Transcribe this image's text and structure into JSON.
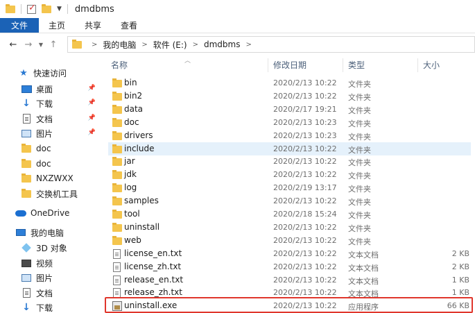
{
  "window": {
    "title": "dmdbms"
  },
  "ribbon": {
    "tabs": [
      "文件",
      "主页",
      "共享",
      "查看"
    ]
  },
  "address": {
    "crumbs": [
      "我的电脑",
      "软件 (E:)",
      "dmdbms"
    ]
  },
  "sidebar": {
    "quick_access": "快速访问",
    "pinned": [
      {
        "label": "桌面",
        "icon": "desktop-icon"
      },
      {
        "label": "下载",
        "icon": "download-icon"
      },
      {
        "label": "文档",
        "icon": "document-icon"
      },
      {
        "label": "图片",
        "icon": "pictures-icon"
      }
    ],
    "recent": [
      "doc",
      "doc",
      "NXZWXX",
      "交换机工具"
    ],
    "onedrive": "OneDrive",
    "this_pc": "我的电脑",
    "pc_items": [
      {
        "label": "3D 对象",
        "icon": "3d-objects-icon"
      },
      {
        "label": "视频",
        "icon": "video-icon"
      },
      {
        "label": "图片",
        "icon": "pictures-icon"
      },
      {
        "label": "文档",
        "icon": "document-icon"
      },
      {
        "label": "下载",
        "icon": "download-icon"
      }
    ]
  },
  "columns": {
    "name": "名称",
    "date": "修改日期",
    "type": "类型",
    "size": "大小"
  },
  "files": [
    {
      "name": "bin",
      "date": "2020/2/13 10:22",
      "type": "文件夹",
      "size": "",
      "kind": "folder"
    },
    {
      "name": "bin2",
      "date": "2020/2/13 10:22",
      "type": "文件夹",
      "size": "",
      "kind": "folder"
    },
    {
      "name": "data",
      "date": "2020/2/17 19:21",
      "type": "文件夹",
      "size": "",
      "kind": "folder"
    },
    {
      "name": "doc",
      "date": "2020/2/13 10:23",
      "type": "文件夹",
      "size": "",
      "kind": "folder"
    },
    {
      "name": "drivers",
      "date": "2020/2/13 10:23",
      "type": "文件夹",
      "size": "",
      "kind": "folder"
    },
    {
      "name": "include",
      "date": "2020/2/13 10:22",
      "type": "文件夹",
      "size": "",
      "kind": "folder",
      "selected": true
    },
    {
      "name": "jar",
      "date": "2020/2/13 10:22",
      "type": "文件夹",
      "size": "",
      "kind": "folder"
    },
    {
      "name": "jdk",
      "date": "2020/2/13 10:22",
      "type": "文件夹",
      "size": "",
      "kind": "folder"
    },
    {
      "name": "log",
      "date": "2020/2/19 13:17",
      "type": "文件夹",
      "size": "",
      "kind": "folder"
    },
    {
      "name": "samples",
      "date": "2020/2/13 10:22",
      "type": "文件夹",
      "size": "",
      "kind": "folder"
    },
    {
      "name": "tool",
      "date": "2020/2/18 15:24",
      "type": "文件夹",
      "size": "",
      "kind": "folder"
    },
    {
      "name": "uninstall",
      "date": "2020/2/13 10:22",
      "type": "文件夹",
      "size": "",
      "kind": "folder"
    },
    {
      "name": "web",
      "date": "2020/2/13 10:22",
      "type": "文件夹",
      "size": "",
      "kind": "folder"
    },
    {
      "name": "license_en.txt",
      "date": "2020/2/13 10:22",
      "type": "文本文档",
      "size": "2 KB",
      "kind": "txt"
    },
    {
      "name": "license_zh.txt",
      "date": "2020/2/13 10:22",
      "type": "文本文档",
      "size": "2 KB",
      "kind": "txt"
    },
    {
      "name": "release_en.txt",
      "date": "2020/2/13 10:22",
      "type": "文本文档",
      "size": "1 KB",
      "kind": "txt"
    },
    {
      "name": "release_zh.txt",
      "date": "2020/2/13 10:22",
      "type": "文本文档",
      "size": "1 KB",
      "kind": "txt"
    },
    {
      "name": "uninstall.exe",
      "date": "2020/2/13 10:22",
      "type": "应用程序",
      "size": "66 KB",
      "kind": "exe"
    }
  ],
  "colors": {
    "file_tab": "#1b62b6",
    "selected_row": "#e5f1fb",
    "highlight": "#e0362c",
    "folder": "#f4c54d"
  }
}
